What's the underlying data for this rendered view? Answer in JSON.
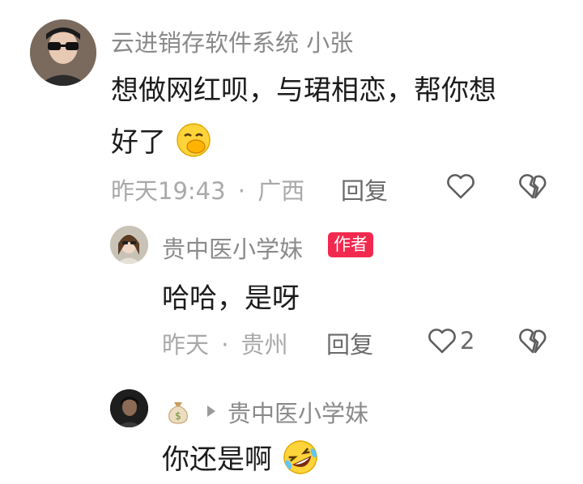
{
  "comments": [
    {
      "author": "云进销存软件系统 小张",
      "text_line1": "想做网红呗，与珺相恋，帮你想",
      "text_line2": "好了",
      "emoji": "hand-over-mouth-emoji",
      "time": "昨天19:43",
      "location": "广西",
      "reply_label": "回复",
      "like_icon": "heart-icon",
      "dislike_icon": "broken-heart-icon"
    },
    {
      "author": "贵中医小学妹",
      "badge": "作者",
      "text": "哈哈，是呀",
      "time": "昨天",
      "location": "贵州",
      "reply_label": "回复",
      "like_icon": "heart-icon",
      "like_count": "2",
      "dislike_icon": "broken-heart-icon"
    },
    {
      "author_emoji": "money-bag-emoji",
      "reply_to": "贵中医小学妹",
      "text": "你还是啊",
      "emoji": "rolling-laughing-emoji"
    }
  ],
  "separator": "·",
  "colors": {
    "badge": "#f2294f",
    "meta": "#a9a9a9",
    "name": "#8a8a8a"
  }
}
